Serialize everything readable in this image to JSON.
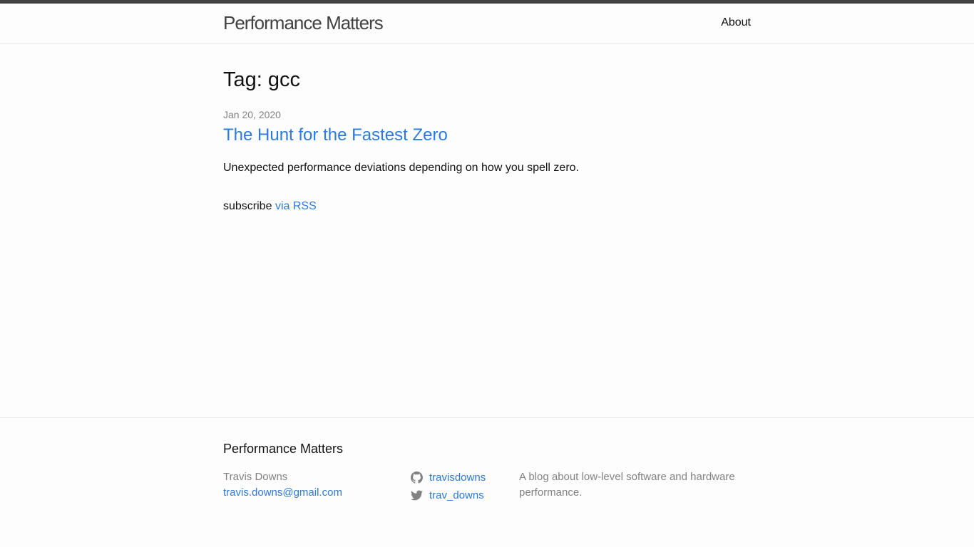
{
  "header": {
    "site_title": "Performance Matters",
    "nav_about": "About"
  },
  "main": {
    "heading": "Tag: gcc",
    "posts": [
      {
        "date": "Jan 20, 2020",
        "title": "The Hunt for the Fastest Zero",
        "excerpt": "Unexpected performance deviations depending on how you spell zero."
      }
    ],
    "subscribe_text": "subscribe",
    "subscribe_link": "via RSS"
  },
  "footer": {
    "heading": "Performance Matters",
    "author_name": "Travis Downs",
    "author_email": "travis.downs@gmail.com",
    "github_username": "travisdowns",
    "twitter_username": "trav_downs",
    "description": "A blog about low-level software and hardware performance."
  },
  "colors": {
    "link": "#2a7ae2",
    "meta_grey": "#828282",
    "topbar": "#424242"
  },
  "icons": [
    "github-icon",
    "twitter-icon"
  ]
}
